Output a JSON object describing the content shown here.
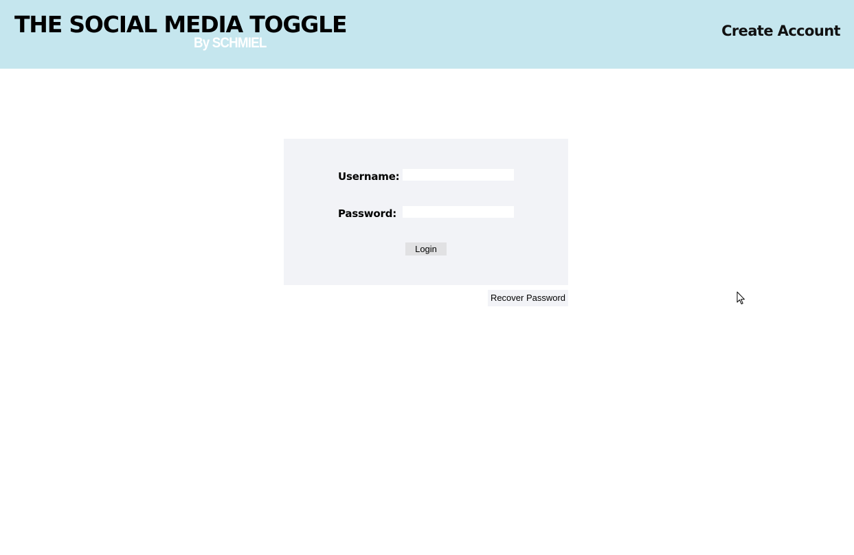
{
  "header": {
    "title": "THE SOCIAL MEDIA TOGGLE",
    "byline": "By SCHMIEL",
    "create_account_label": "Create Account",
    "background_color": "#c5e6ee"
  },
  "login_form": {
    "username_label": "Username:",
    "username_value": "",
    "password_label": "Password:",
    "password_value": "",
    "login_button_label": "Login",
    "panel_color": "#f2f3f7"
  },
  "recover_password_label": "Recover Password",
  "cursor_icon": "arrow-pointer-icon"
}
